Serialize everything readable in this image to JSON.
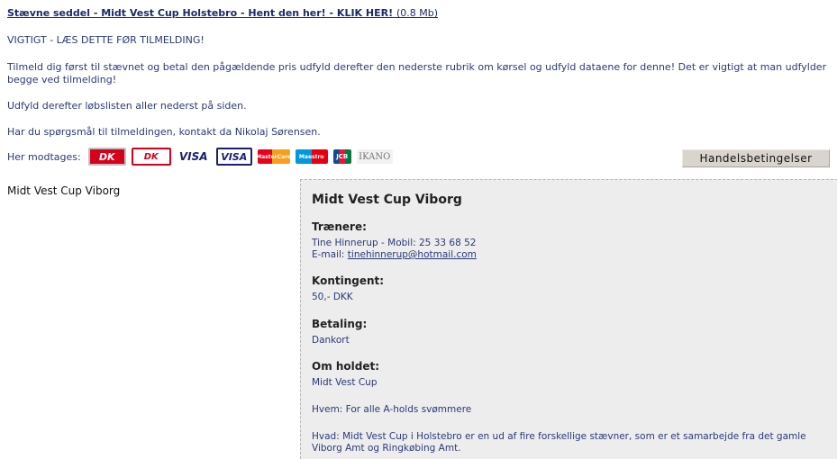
{
  "header": {
    "link_text": "Stævne seddel - Midt Vest Cup Holstebro - Hent den her! - KLIK HER!",
    "link_size": "(0.8 Mb)"
  },
  "intro": {
    "important": "VIGTIGT - LÆS DETTE FØR TILMELDING!",
    "instructions": "Tilmeld dig først til stævnet og betal den pågældende pris udfyld derefter den nederste rubrik om kørsel og udfyld dataene for denne! Det er vigtigt at man udfylder begge ved tilmelding!",
    "runner_list": "Udfyld derefter løbslisten aller nederst på siden.",
    "questions": "Har du spørgsmål til tilmeldingen, kontakt da Nikolaj Sørensen."
  },
  "payment": {
    "label": "Her modtages:",
    "cards": [
      {
        "text": "DK",
        "icon": "dankort-icon"
      },
      {
        "text": "DK",
        "icon": "dankort-outline-icon"
      },
      {
        "text": "VISA",
        "icon": "visa-icon"
      },
      {
        "text": "VISA",
        "icon": "visa-electron-icon"
      },
      {
        "text": "MasterCard",
        "icon": "mastercard-icon"
      },
      {
        "text": "Maestro",
        "icon": "maestro-icon"
      },
      {
        "text": "JCB",
        "icon": "jcb-icon"
      },
      {
        "text": "IKANO",
        "icon": "ikano-icon"
      }
    ],
    "terms_button": "Handelsbetingelser"
  },
  "event": {
    "left_title": "Midt Vest Cup Viborg",
    "panel_title": "Midt Vest Cup Viborg",
    "trainers_heading": "Trænere:",
    "trainers_line1": "Tine Hinnerup - Mobil: 25 33 68 52",
    "trainers_email_label": "E-mail: ",
    "trainers_email": "tinehinnerup@hotmail.com",
    "fee_heading": "Kontingent:",
    "fee_value": "50,- DKK",
    "payment_heading": "Betaling:",
    "payment_value": "Dankort",
    "team_heading": "Om holdet:",
    "team_name": "Midt Vest Cup",
    "who": "Hvem: For alle A-holds svømmere",
    "what": "Hvad: Midt Vest Cup i Holstebro er en ud af fire forskellige stævner, som er et samarbejde fra det gamle Viborg Amt og Ringkøbing Amt."
  },
  "colors": {
    "link": "#1b2a6b",
    "text": "#2a3a78",
    "panel_bg": "#ededed",
    "button_bg": "#d9d4cd"
  }
}
